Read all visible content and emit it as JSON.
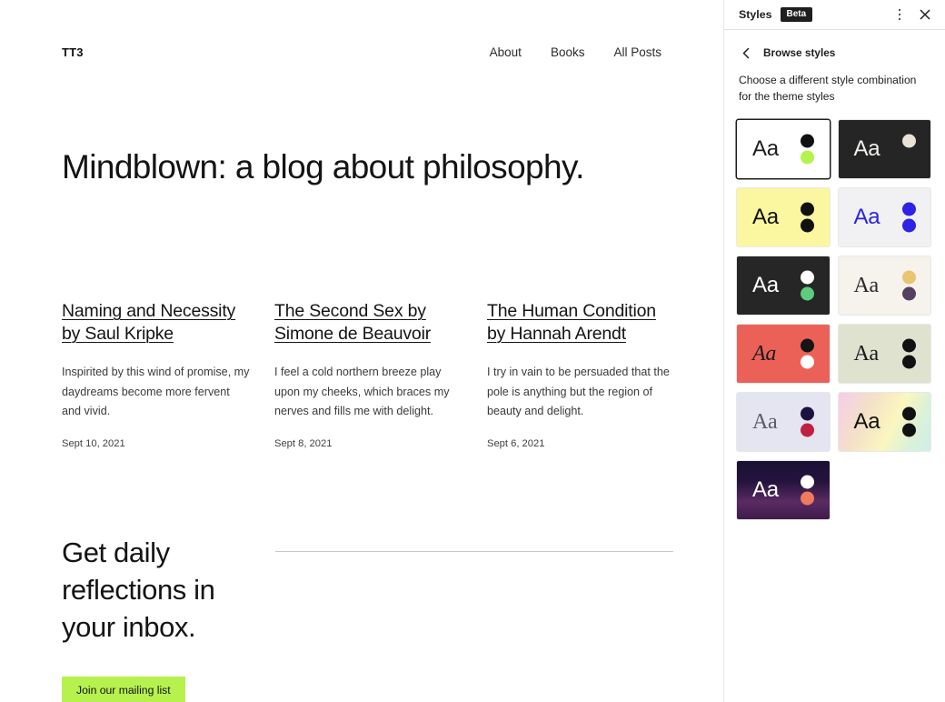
{
  "canvas": {
    "site_title": "TT3",
    "nav": [
      {
        "label": "About"
      },
      {
        "label": "Books"
      },
      {
        "label": "All Posts"
      }
    ],
    "hero_title": "Mindblown: a blog about philosophy.",
    "posts": [
      {
        "title": "Naming and Necessity by Saul Kripke",
        "excerpt": "Inspirited by this wind of promise, my daydreams become more fervent and vivid.",
        "date": "Sept 10, 2021"
      },
      {
        "title": "The Second Sex by Simone de Beauvoir",
        "excerpt": "I feel a cold northern breeze play upon my cheeks, which braces my nerves and fills me with delight.",
        "date": "Sept 8, 2021"
      },
      {
        "title": "The Human Condition by Hannah Arendt",
        "excerpt": "I try in vain to be persuaded that the pole is anything but the region of beauty and delight.",
        "date": "Sept 6, 2021"
      }
    ],
    "cta": {
      "title": "Get daily reflections in your inbox.",
      "button_label": "Join our mailing list",
      "button_color": "#b7f14e"
    }
  },
  "sidebar": {
    "title": "Styles",
    "badge": "Beta",
    "more_icon": "kebab-menu-icon",
    "close_icon": "close-icon",
    "back_icon": "chevron-left-icon",
    "subtitle": "Browse styles",
    "description": "Choose a different style combination for the theme styles",
    "style_cards": [
      {
        "name": "style-variation-1",
        "sample_text": "Aa",
        "selected": true,
        "background": "#ffffff",
        "text_color": "#1e1e1e",
        "font": "sans",
        "dot_top": "#111111",
        "dot_bottom": "#b4f24d"
      },
      {
        "name": "style-variation-2",
        "sample_text": "Aa",
        "selected": false,
        "background": "#252525",
        "text_color": "#f2f0ea",
        "font": "sans",
        "dot_top": "#e8e3d4",
        "dot_bottom": "#8a7c४f"
      },
      {
        "name": "style-variation-3",
        "sample_text": "Aa",
        "selected": false,
        "background": "#fbf6a0",
        "text_color": "#111111",
        "font": "sans",
        "dot_top": "#111111",
        "dot_bottom": "#111111"
      },
      {
        "name": "style-variation-4",
        "sample_text": "Aa",
        "selected": false,
        "background": "#f1f1f4",
        "text_color": "#2c22e8",
        "font": "sans",
        "dot_top": "#2c22e8",
        "dot_bottom": "#2c22e8"
      },
      {
        "name": "style-variation-5",
        "sample_text": "Aa",
        "selected": false,
        "background": "#262626",
        "text_color": "#ffffff",
        "font": "sans",
        "dot_top": "#ffffff",
        "dot_bottom": "#5fcb7e"
      },
      {
        "name": "style-variation-6",
        "sample_text": "Aa",
        "selected": false,
        "background": "#f6f2ec",
        "text_color": "#2b2b2b",
        "font": "serif",
        "dot_top": "#e8c570",
        "dot_bottom": "#55415f"
      },
      {
        "name": "style-variation-7",
        "sample_text": "Aa",
        "selected": false,
        "background": "#ec6157",
        "text_color": "#1a1a1a",
        "font": "serif-italic",
        "dot_top": "#151515",
        "dot_bottom": "#ffffff"
      },
      {
        "name": "style-variation-8",
        "sample_text": "Aa",
        "selected": false,
        "background": "#dfe2cf",
        "text_color": "#1a1a1a",
        "font": "serif",
        "dot_top": "#111111",
        "dot_bottom": "#111111"
      },
      {
        "name": "style-variation-9",
        "sample_text": "Aa",
        "selected": false,
        "background": "#e4e5f0",
        "text_color": "#5c5c66",
        "font": "serif",
        "dot_top": "#1c1240",
        "dot_bottom": "#bf2142"
      },
      {
        "name": "style-variation-10",
        "sample_text": "Aa",
        "selected": false,
        "background": "linear-gradient(115deg, #f7ccea 0%, #f3e0c8 30%, #fbf6bf 58%, #d9f2d8 80%, #cfeee8 100%)",
        "text_color": "#111111",
        "font": "sans",
        "dot_top": "#111111",
        "dot_bottom": "#111111"
      },
      {
        "name": "style-variation-11",
        "sample_text": "Aa",
        "selected": false,
        "background": "linear-gradient(180deg, #1b1033 0%, #23133d 35%, #5a2b63 70%, #3e1b4a 100%)",
        "text_color": "#ffffff",
        "font": "sans",
        "dot_top": "#ffffff",
        "dot_bottom": "#ef7a5e"
      }
    ]
  }
}
